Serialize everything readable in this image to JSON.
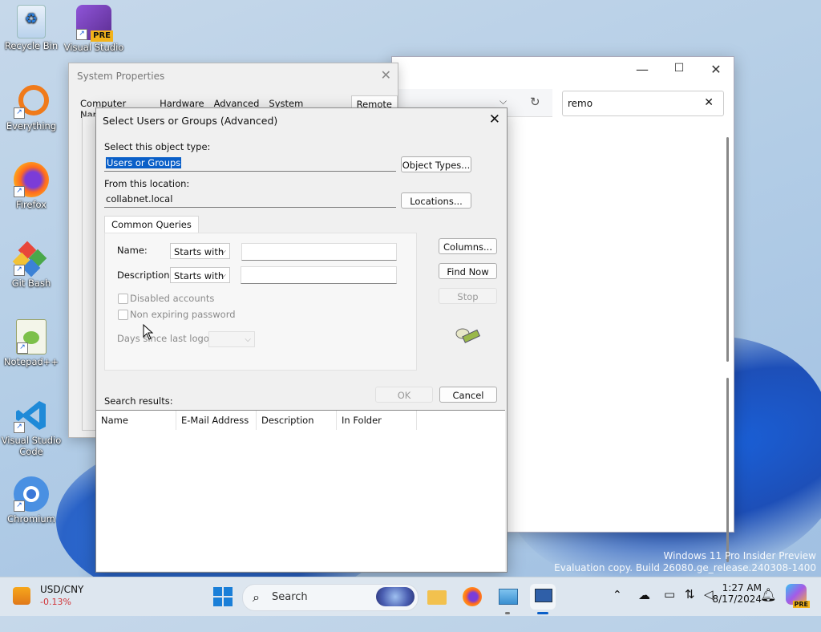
{
  "desktop": {
    "icons": [
      {
        "label": "Recycle Bin"
      },
      {
        "label": "Visual Studio"
      },
      {
        "label": "Everything"
      },
      {
        "label": "Firefox"
      },
      {
        "label": "Git Bash"
      },
      {
        "label": "Notepad++"
      },
      {
        "label": "Visual Studio Code"
      },
      {
        "label": "Chromium"
      }
    ],
    "vs_badge": "PRE",
    "watermark_line1": "Windows 11 Pro Insider Preview",
    "watermark_line2": "Evaluation copy. Build 26080.ge_release.240308-1400"
  },
  "explorer": {
    "search_value": "remo",
    "minimize": "—",
    "maximize": "☐",
    "close": "✕",
    "refresh": "↻",
    "dropdown": "⌵"
  },
  "system_properties": {
    "title": "System Properties",
    "tabs": [
      "Computer Name",
      "Hardware",
      "Advanced",
      "System Protection",
      "Remote"
    ],
    "active_tab": "Remote"
  },
  "advanced_dialog": {
    "title": "Select Users or Groups (Advanced)",
    "object_type_label": "Select this object type:",
    "object_type_value": "Users or Groups",
    "object_types_button": "Object Types...",
    "location_label": "From this location:",
    "location_value": "collabnet.local",
    "locations_button": "Locations...",
    "common_queries_tab": "Common Queries",
    "name_label": "Name:",
    "name_combo": "Starts with",
    "description_label": "Description:",
    "description_combo": "Starts with",
    "disabled_accounts": "Disabled accounts",
    "non_expiring_password": "Non expiring password",
    "days_since_last_logon": "Days since last logon:",
    "columns_button": "Columns...",
    "find_now_button": "Find Now",
    "stop_button": "Stop",
    "ok_button": "OK",
    "cancel_button": "Cancel",
    "search_results_label": "Search results:",
    "columns": [
      "Name",
      "E-Mail Address",
      "Description",
      "In Folder"
    ]
  },
  "taskbar": {
    "stock_symbol": "USD/CNY",
    "stock_change": "-0.13%",
    "search_placeholder": "Search",
    "time": "1:27 AM",
    "date": "8/17/2024",
    "colors": {
      "stock_negative": "#d13438",
      "accent": "#0a5fc8"
    }
  }
}
